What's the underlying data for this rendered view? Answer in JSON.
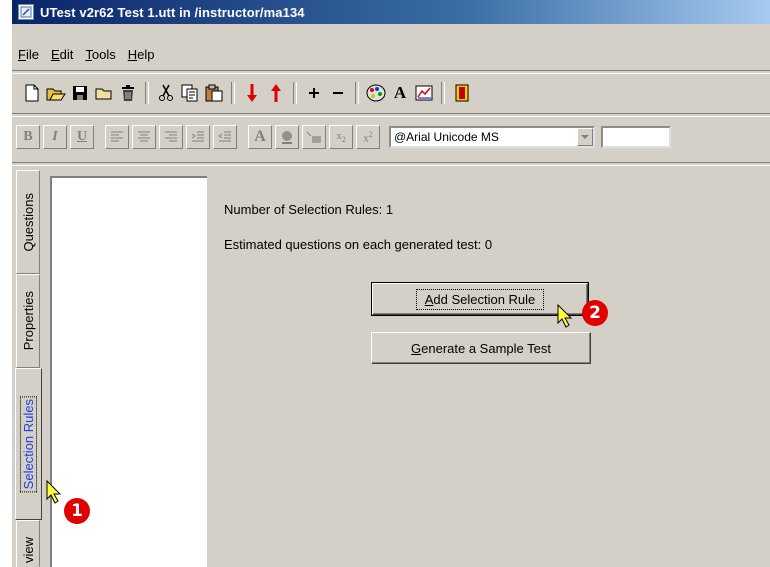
{
  "window": {
    "title": "UTest v2r62 Test 1.utt in /instructor/ma134"
  },
  "menubar": [
    {
      "first": "F",
      "rest": "ile"
    },
    {
      "first": "E",
      "rest": "dit"
    },
    {
      "first": "T",
      "rest": "ools"
    },
    {
      "first": "H",
      "rest": "elp"
    }
  ],
  "format_toolbar": {
    "bold": "B",
    "italic": "I",
    "underline": "U",
    "font_name": "@Arial Unicode MS",
    "font_size": ""
  },
  "side_tabs": {
    "questions": "Questions",
    "properties": "Properties",
    "selection_rules": "Selection Rules",
    "preview": "view"
  },
  "main": {
    "rule_count_text": "Number of Selection Rules:  1",
    "estimate_text": "Estimated questions on each generated test:   0",
    "add_rule": {
      "mnemonic": "A",
      "rest": "dd Selection Rule"
    },
    "generate_test": {
      "mnemonic": "G",
      "rest": "enerate a Sample Test"
    }
  },
  "annotations": {
    "step1": "1",
    "step2": "2"
  },
  "colors": {
    "titlebar": "#0a246a",
    "active_tab_text": "#2040e0",
    "badge": "#e00000"
  }
}
